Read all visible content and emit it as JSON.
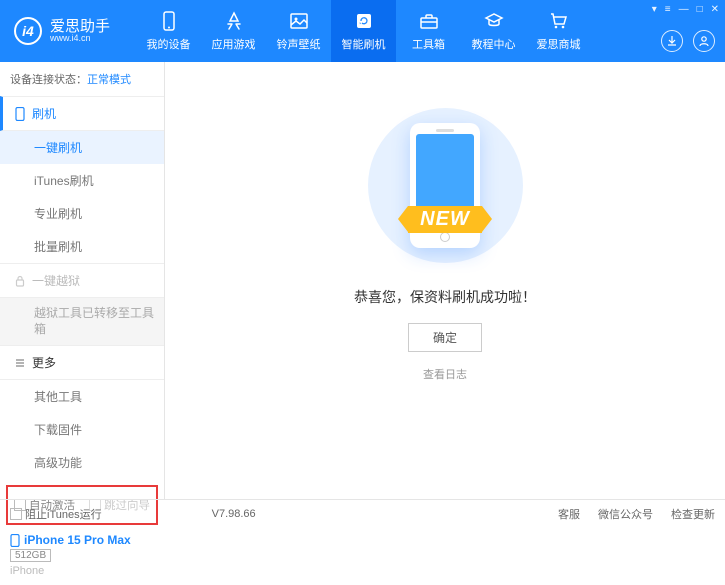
{
  "app": {
    "title": "爱思助手",
    "url": "www.i4.cn"
  },
  "nav": {
    "items": [
      {
        "label": "我的设备"
      },
      {
        "label": "应用游戏"
      },
      {
        "label": "铃声壁纸"
      },
      {
        "label": "智能刷机"
      },
      {
        "label": "工具箱"
      },
      {
        "label": "教程中心"
      },
      {
        "label": "爱思商城"
      }
    ],
    "activeIndex": 3
  },
  "status": {
    "prefix": "设备连接状态：",
    "mode": "正常模式"
  },
  "sidebar": {
    "flash": {
      "head": "刷机",
      "items": [
        "一键刷机",
        "iTunes刷机",
        "专业刷机",
        "批量刷机"
      ],
      "activeIndex": 0
    },
    "jailbreak": {
      "head": "一键越狱",
      "migrated": "越狱工具已转移至工具箱"
    },
    "more": {
      "head": "更多",
      "items": [
        "其他工具",
        "下载固件",
        "高级功能"
      ]
    },
    "options": {
      "autoActivate": "自动激活",
      "skipGuide": "跳过向导"
    },
    "device": {
      "name": "iPhone 15 Pro Max",
      "storage": "512GB",
      "type": "iPhone"
    }
  },
  "main": {
    "ribbon": "NEW",
    "successMsg": "恭喜您，保资料刷机成功啦！",
    "okBtn": "确定",
    "logLink": "查看日志"
  },
  "footer": {
    "blockItunes": "阻止iTunes运行",
    "version": "V7.98.66",
    "links": [
      "客服",
      "微信公众号",
      "检查更新"
    ]
  }
}
